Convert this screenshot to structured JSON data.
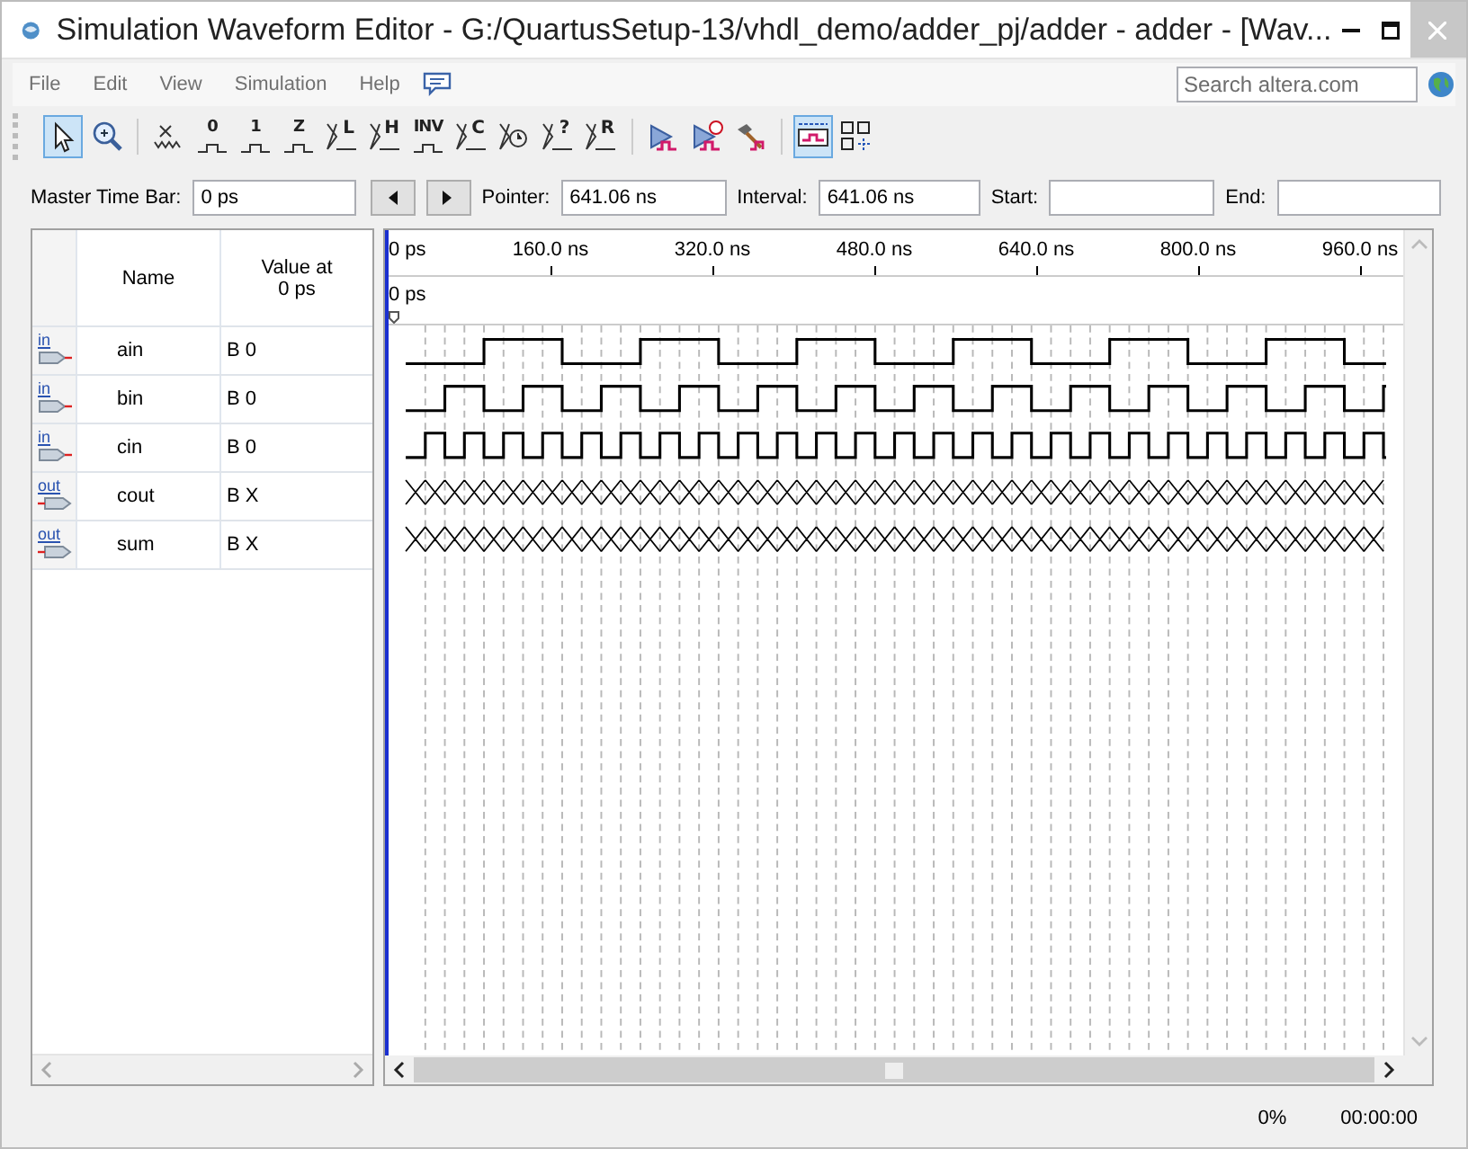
{
  "window": {
    "title": "Simulation Waveform Editor - G:/QuartusSetup-13/vhdl_demo/adder_pj/adder - adder - [Wav..."
  },
  "menu": [
    "File",
    "Edit",
    "View",
    "Simulation",
    "Help"
  ],
  "search": {
    "placeholder": "Search altera.com"
  },
  "toolbar": [
    [
      {
        "kind": "pointer",
        "selected": true
      },
      {
        "kind": "zoom",
        "selected": false
      }
    ],
    [
      {
        "kind": "unknown",
        "selected": false
      },
      {
        "kind": "force",
        "glyph": "0",
        "selected": false
      },
      {
        "kind": "force",
        "glyph": "1",
        "selected": false
      },
      {
        "kind": "force",
        "glyph": "Z",
        "selected": false
      },
      {
        "kind": "bus",
        "glyph": "L",
        "selected": false
      },
      {
        "kind": "bus",
        "glyph": "H",
        "selected": false
      },
      {
        "kind": "force",
        "glyph": "INV",
        "selected": false
      },
      {
        "kind": "bus",
        "glyph": "C",
        "selected": false
      },
      {
        "kind": "clock",
        "selected": false
      },
      {
        "kind": "bus",
        "glyph": "?",
        "selected": false
      },
      {
        "kind": "bus",
        "glyph": "R",
        "selected": false
      }
    ],
    [
      {
        "kind": "run",
        "selected": false
      },
      {
        "kind": "run-timing",
        "selected": false
      },
      {
        "kind": "netlist",
        "selected": false
      }
    ],
    [
      {
        "kind": "snap",
        "selected": true
      },
      {
        "kind": "grid",
        "selected": false
      }
    ]
  ],
  "time_bar": {
    "master_label": "Master Time Bar:",
    "master_value": "0 ps",
    "pointer_label": "Pointer:",
    "pointer_value": "641.06 ns",
    "interval_label": "Interval:",
    "interval_value": "641.06 ns",
    "start_label": "Start:",
    "end_label": "End:"
  },
  "table": {
    "columns": [
      "Name",
      "Value at 0 ps"
    ]
  },
  "signals": [
    {
      "direction": "in",
      "name": "ain",
      "value": "B 0"
    },
    {
      "direction": "in",
      "name": "bin",
      "value": "B 0"
    },
    {
      "direction": "in",
      "name": "cin",
      "value": "B 0"
    },
    {
      "direction": "out",
      "name": "cout",
      "value": "B X"
    },
    {
      "direction": "out",
      "name": "sum",
      "value": "B X"
    }
  ],
  "timeline": {
    "ticks": [
      "0 ps",
      "160.0 ns",
      "320.0 ns",
      "480.0 ns",
      "640.0 ns",
      "800.0 ns",
      "960.0 ns"
    ],
    "marker": "0 ps"
  },
  "status": {
    "progress": "0%",
    "elapsed": "00:00:00"
  }
}
